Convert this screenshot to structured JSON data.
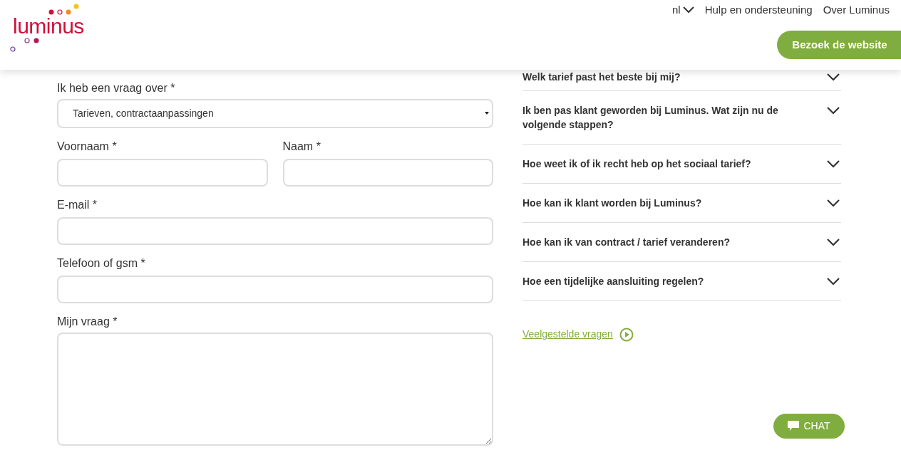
{
  "header": {
    "logo": "luminus",
    "language": "nl",
    "nav": [
      "Hulp en ondersteuning",
      "Over Luminus"
    ],
    "cta": "Bezoek de website"
  },
  "form": {
    "topic": {
      "label": "Ik heb een vraag over *",
      "value": "Tarieven, contractaanpassingen"
    },
    "first_name": {
      "label": "Voornaam *"
    },
    "last_name": {
      "label": "Naam *"
    },
    "email": {
      "label": "E-mail *"
    },
    "phone": {
      "label": "Telefoon of gsm *"
    },
    "question": {
      "label": "Mijn vraag *"
    }
  },
  "faq": {
    "items": [
      {
        "question": "Welk tarief past het beste bij mij?",
        "expanded": false
      },
      {
        "question": "Ik ben pas klant geworden bij Luminus. Wat zijn nu de volgende stappen?",
        "expanded": false
      },
      {
        "question": "Hoe weet ik of ik recht heb op het sociaal tarief?",
        "expanded": false
      },
      {
        "question": "Hoe kan ik klant worden bij Luminus?",
        "expanded": false
      },
      {
        "question": "Hoe kan ik van contract / tarief veranderen?",
        "expanded": false
      },
      {
        "question": "Hoe een tijdelijke aansluiting regelen?",
        "expanded": false
      }
    ],
    "link": "Veelgestelde vragen"
  },
  "chat": "CHAT"
}
